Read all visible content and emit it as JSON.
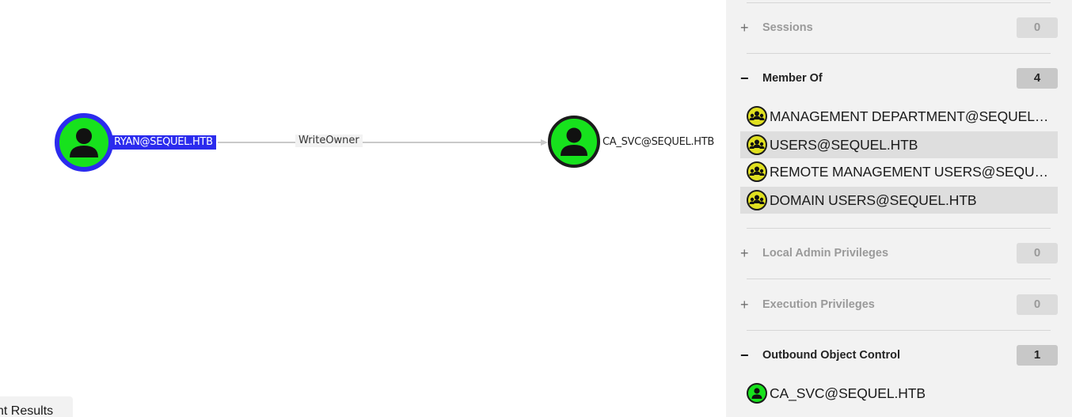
{
  "graph": {
    "nodes": [
      {
        "label": "RYAN@SEQUEL.HTB",
        "selected": true
      },
      {
        "label": "CA_SVC@SEQUEL.HTB",
        "selected": false
      }
    ],
    "edge": {
      "label": "WriteOwner"
    }
  },
  "bottom_tab": {
    "label": "nt Results"
  },
  "panel": {
    "sessions": {
      "title": "Sessions",
      "count": "0",
      "expanded": false,
      "toggle": "+"
    },
    "member_of": {
      "title": "Member Of",
      "count": "4",
      "expanded": true,
      "toggle": "−",
      "items": [
        "MANAGEMENT DEPARTMENT@SEQUEL.HTB",
        "USERS@SEQUEL.HTB",
        "REMOTE MANAGEMENT USERS@SEQUEL.HTB",
        "DOMAIN USERS@SEQUEL.HTB"
      ]
    },
    "local_admin": {
      "title": "Local Admin Privileges",
      "count": "0",
      "expanded": false,
      "toggle": "+"
    },
    "execution": {
      "title": "Execution Privileges",
      "count": "0",
      "expanded": false,
      "toggle": "+"
    },
    "outbound": {
      "title": "Outbound Object Control",
      "count": "1",
      "expanded": true,
      "toggle": "−",
      "items": [
        "CA_SVC@SEQUEL.HTB"
      ]
    }
  },
  "colors": {
    "user_node": "#17e21d",
    "group_node": "#e0e020",
    "selection": "#2b2bee"
  }
}
